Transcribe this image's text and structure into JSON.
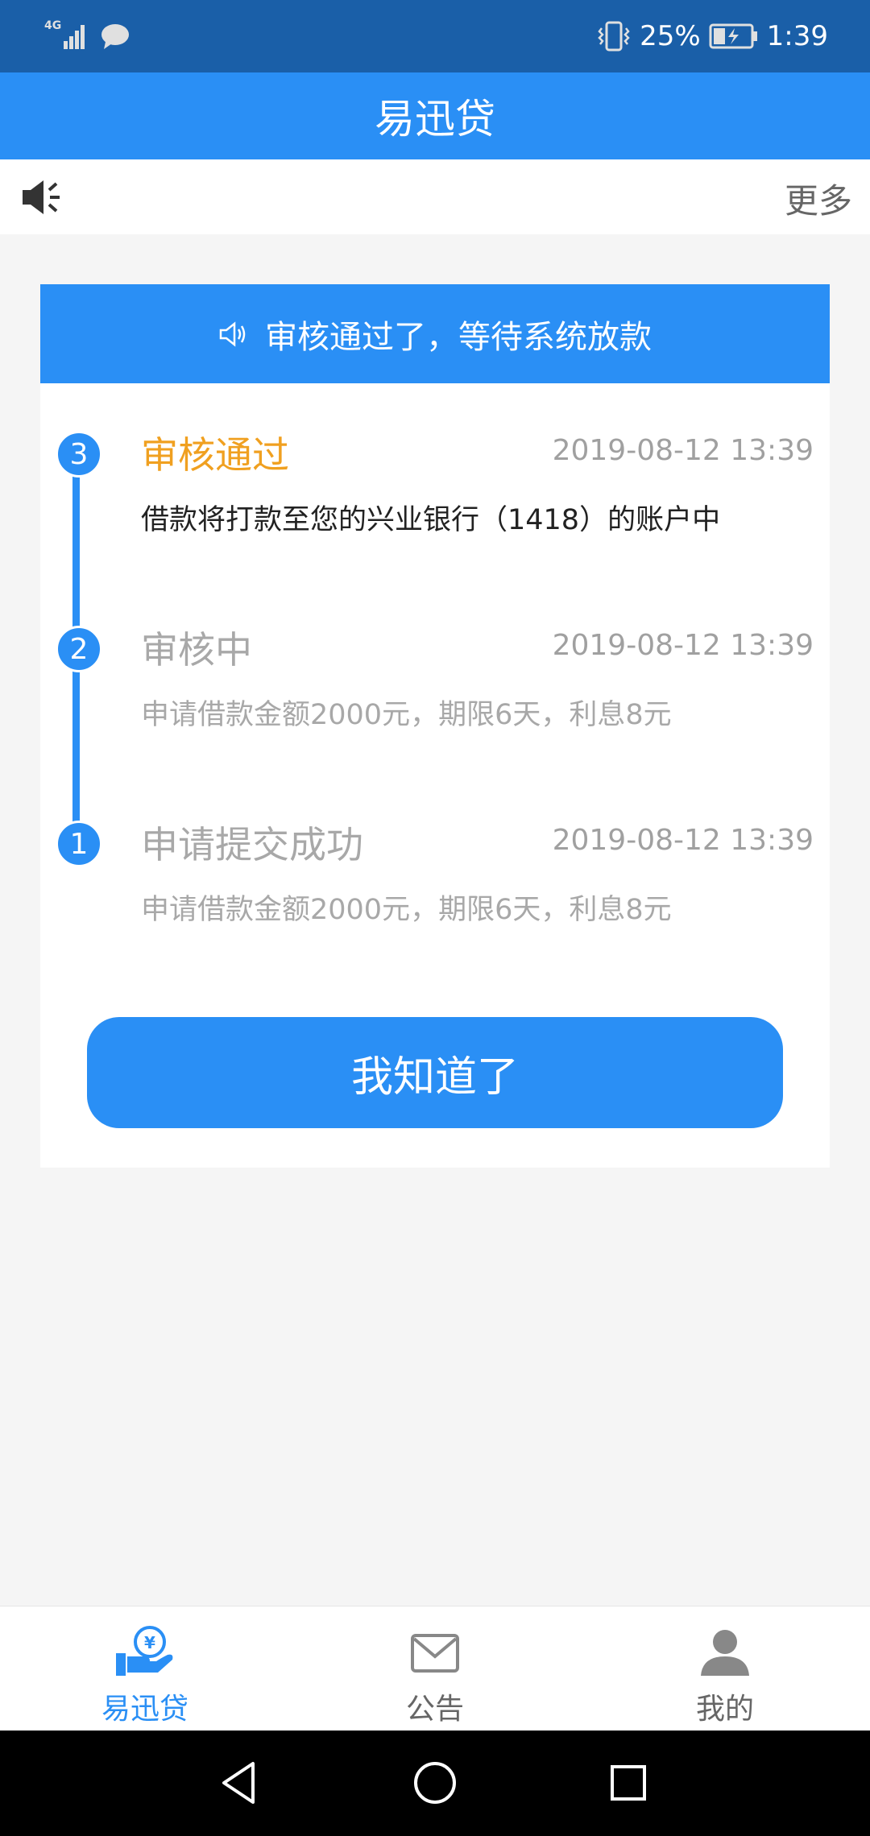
{
  "status_bar": {
    "network": "4G",
    "battery_percent": "25%",
    "time": "1:39",
    "icons": [
      "signal-icon",
      "message-icon",
      "vibrate-icon",
      "battery-icon"
    ]
  },
  "header": {
    "title": "易迅贷"
  },
  "notice_bar": {
    "more_label": "更多"
  },
  "card": {
    "banner_text": "审核通过了，等待系统放款",
    "steps": [
      {
        "number": "3",
        "title": "审核通过",
        "time": "2019-08-12 13:39",
        "description": "借款将打款至您的兴业银行（1418）的账户中",
        "state": "active"
      },
      {
        "number": "2",
        "title": "审核中",
        "time": "2019-08-12 13:39",
        "description": "申请借款金额2000元，期限6天，利息8元",
        "state": "inactive"
      },
      {
        "number": "1",
        "title": "申请提交成功",
        "time": "2019-08-12 13:39",
        "description": "申请借款金额2000元，期限6天，利息8元",
        "state": "inactive"
      }
    ],
    "confirm_button": "我知道了"
  },
  "tab_bar": {
    "tabs": [
      {
        "label": "易迅贷",
        "icon": "loan-hand-icon",
        "active": true
      },
      {
        "label": "公告",
        "icon": "mail-icon",
        "active": false
      },
      {
        "label": "我的",
        "icon": "user-icon",
        "active": false
      }
    ]
  },
  "colors": {
    "status_bar": "#1a5fa8",
    "primary": "#2a8ff5",
    "active_step": "#f0a020",
    "inactive_text": "#a8a8a8",
    "background": "#f5f5f5"
  }
}
